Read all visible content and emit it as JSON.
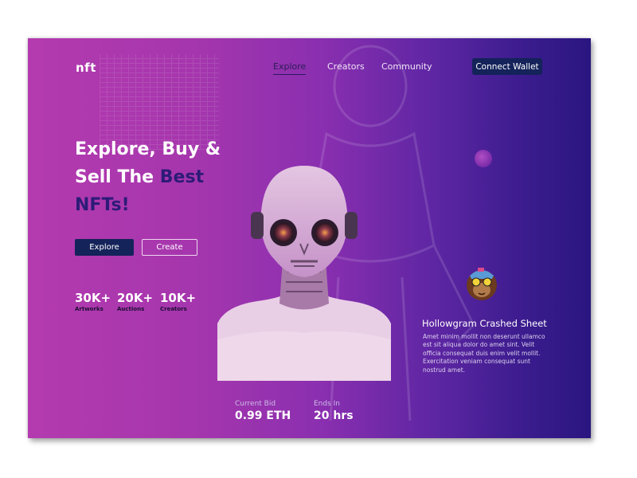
{
  "brand": {
    "logo_text": "nft"
  },
  "nav": {
    "items": [
      {
        "label": "Explore",
        "active": true
      },
      {
        "label": "Creators",
        "active": false
      },
      {
        "label": "Community",
        "active": false
      }
    ],
    "connect_label": "Connect Wallet"
  },
  "hero": {
    "title_line1": "Explore, Buy &",
    "title_line2_plain": "Sell The",
    "title_line2_accent": "Best",
    "title_line3_accent": "NFTs!",
    "explore_label": "Explore",
    "create_label": "Create"
  },
  "stats": [
    {
      "value": "30K+",
      "label": "Artworks"
    },
    {
      "value": "20K+",
      "label": "Auctions"
    },
    {
      "value": "10K+",
      "label": "Creators"
    }
  ],
  "featured": {
    "title": "Hollowgram Crashed Sheet",
    "description": "Amet minim mollit non deserunt ullamco est sit aliqua dolor do amet sint. Velit officia consequat duis enim velit mollit. Exercitation veniam consequat sunt nostrud amet."
  },
  "auction": {
    "current_bid_label": "Current Bid",
    "current_bid_value": "0.99 ETH",
    "ends_in_label": "Ends In",
    "ends_in_value": "20 hrs"
  },
  "colors": {
    "gradient_left": "#b43aaf",
    "gradient_right": "#2a1680",
    "button_dark": "#14235a",
    "accent_text": "#2d1b78"
  },
  "icons": {
    "hero_image": "alien-robot-bust-image",
    "avatar": "ape-avatar-icon",
    "orb": "purple-orb-icon"
  }
}
